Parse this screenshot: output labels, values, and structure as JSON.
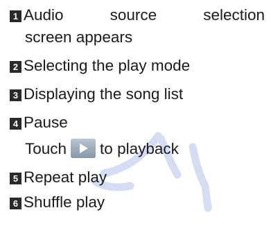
{
  "items": [
    {
      "num": "1",
      "words": [
        "Audio",
        "source",
        "selection"
      ],
      "line2": "screen appears"
    },
    {
      "num": "2",
      "text": "Selecting the play mode"
    },
    {
      "num": "3",
      "text": "Displaying the song list"
    },
    {
      "num": "4",
      "text": "Pause",
      "sub_before": "Touch",
      "sub_icon": "play-icon",
      "sub_after": "to playback"
    },
    {
      "num": "5",
      "text": "Repeat play"
    },
    {
      "num": "6",
      "text": "Shuffle play"
    }
  ],
  "colors": {
    "badge": "#2a2a2a",
    "text": "#1a1a1a",
    "watermark": "#c6d2f0",
    "play_button": "#9aa9b7"
  }
}
